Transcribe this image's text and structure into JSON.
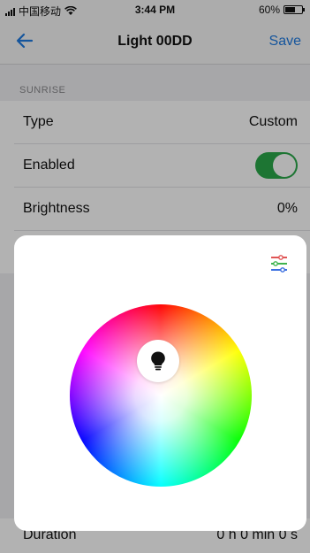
{
  "status_bar": {
    "carrier": "中国移动",
    "time": "3:44 PM",
    "battery_text": "60%",
    "battery_level": 0.6
  },
  "nav": {
    "title": "Light 00DD",
    "save_label": "Save"
  },
  "section": {
    "label": "SUNRISE"
  },
  "rows": [
    {
      "label": "Type",
      "value": "Custom"
    },
    {
      "label": "Enabled",
      "value": ""
    },
    {
      "label": "Brightness",
      "value": "0%"
    }
  ],
  "duration": {
    "label": "Duration",
    "value": "0 h 0 min 0 s"
  },
  "colors": {
    "accent": "#1f7ae0",
    "toggle_on": "#2aa84a"
  },
  "icons": {
    "back": "arrow-left-icon",
    "mode": "sliders-icon",
    "bulb": "lightbulb-icon",
    "wifi": "wifi-icon",
    "battery": "battery-icon"
  }
}
